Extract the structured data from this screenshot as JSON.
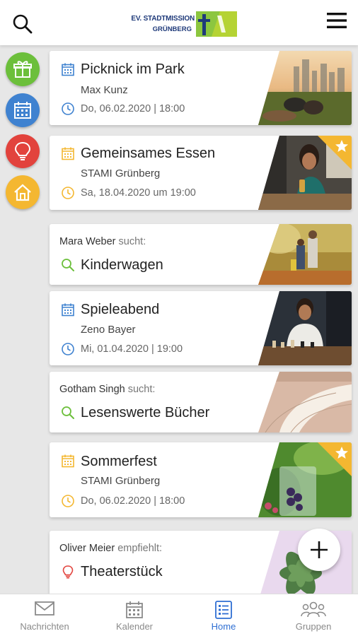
{
  "header": {
    "logo_line1": "EV. STADTMISSION",
    "logo_line2": "GRÜNBERG",
    "search_icon": "search-icon",
    "menu_icon": "hamburger-menu-icon"
  },
  "sidebar": {
    "items": [
      {
        "icon": "gift-icon",
        "color": "#6cbf3b"
      },
      {
        "icon": "calendar-icon",
        "color": "#3f82d0"
      },
      {
        "icon": "lightbulb-icon",
        "color": "#e2433d"
      },
      {
        "icon": "home-icon",
        "color": "#f4b731"
      }
    ]
  },
  "feed": [
    {
      "type": "event",
      "title": "Picknick im Park",
      "organizer": "Max Kunz",
      "date": "Do, 06.02.2020 | 18:00",
      "accent": "#3f82d0",
      "featured": false
    },
    {
      "type": "event",
      "title": "Gemeinsames Essen",
      "organizer": "STAMI Grünberg",
      "date": "Sa, 18.04.2020 um 19:00",
      "accent": "#f4b731",
      "featured": true
    },
    {
      "type": "search",
      "author": "Mara Weber",
      "verb": "sucht:",
      "title": "Kinderwagen",
      "accent": "#6cbf3b"
    },
    {
      "type": "event",
      "title": "Spieleabend",
      "organizer": "Zeno Bayer",
      "date": "Mi, 01.04.2020 | 19:00",
      "accent": "#3f82d0",
      "featured": false
    },
    {
      "type": "search",
      "author": "Gotham Singh",
      "verb": "sucht:",
      "title": "Lesenswerte Bücher",
      "accent": "#6cbf3b"
    },
    {
      "type": "event",
      "title": "Sommerfest",
      "organizer": "STAMI Grünberg",
      "date": "Do, 06.02.2020 | 18:00",
      "accent": "#f4b731",
      "featured": true
    },
    {
      "type": "recommend",
      "author": "Oliver Meier",
      "verb": "empfiehlt:",
      "title": "Theaterstück",
      "accent": "#e2433d"
    }
  ],
  "fab": {
    "icon": "plus-icon"
  },
  "bottom_nav": {
    "tabs": [
      {
        "label": "Nachrichten",
        "icon": "mail-icon",
        "active": false
      },
      {
        "label": "Kalender",
        "icon": "calendar-icon",
        "active": false
      },
      {
        "label": "Home",
        "icon": "list-icon",
        "active": true
      },
      {
        "label": "Gruppen",
        "icon": "group-icon",
        "active": false
      }
    ]
  }
}
